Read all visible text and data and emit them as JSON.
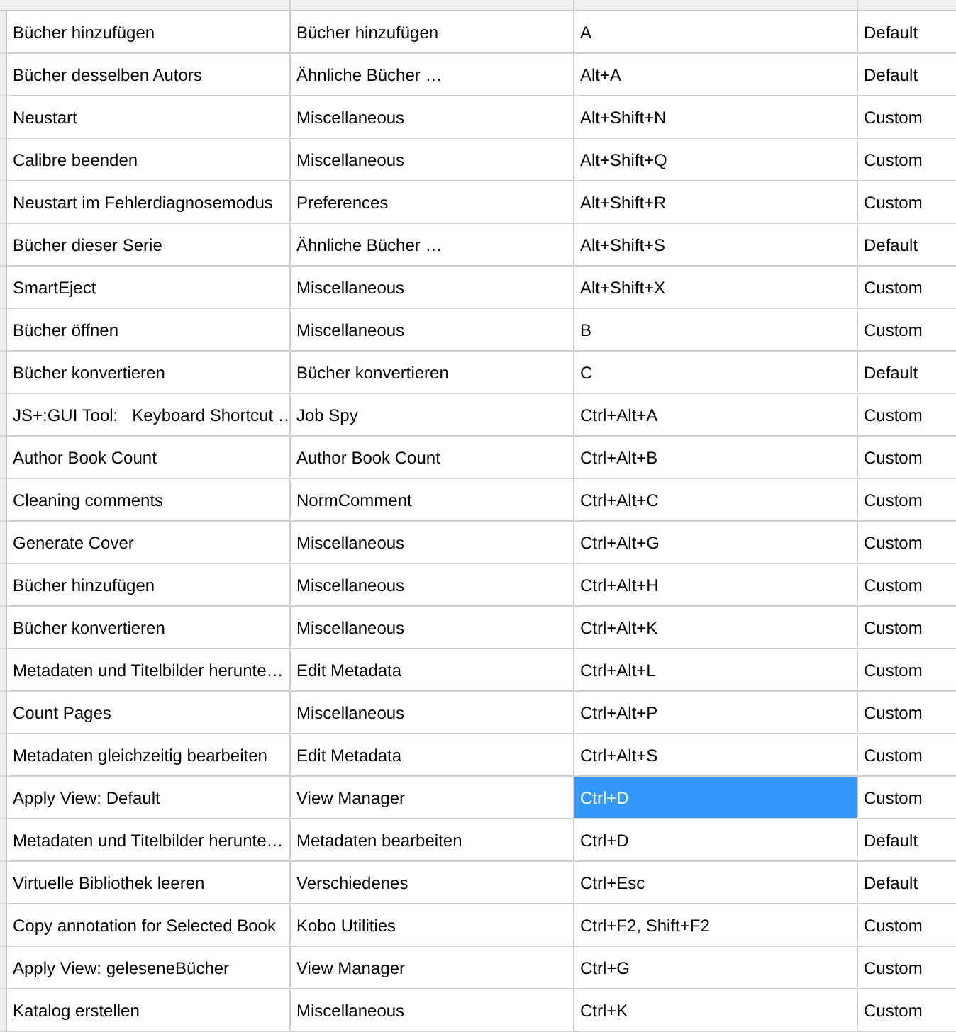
{
  "table": {
    "rows": [
      {
        "name": "Bücher hinzufügen",
        "group": "Bücher hinzufügen",
        "shortcut": "A",
        "source": "Default",
        "selected": false
      },
      {
        "name": "Bücher desselben Autors",
        "group": "Ähnliche Bücher …",
        "shortcut": "Alt+A",
        "source": "Default",
        "selected": false
      },
      {
        "name": "Neustart",
        "group": "Miscellaneous",
        "shortcut": "Alt+Shift+N",
        "source": "Custom",
        "selected": false
      },
      {
        "name": "Calibre beenden",
        "group": "Miscellaneous",
        "shortcut": "Alt+Shift+Q",
        "source": "Custom",
        "selected": false
      },
      {
        "name": "Neustart im Fehlerdiagnosemodus",
        "group": "Preferences",
        "shortcut": "Alt+Shift+R",
        "source": "Custom",
        "selected": false
      },
      {
        "name": "Bücher dieser Serie",
        "group": "Ähnliche Bücher …",
        "shortcut": "Alt+Shift+S",
        "source": "Default",
        "selected": false
      },
      {
        "name": "SmartEject",
        "group": "Miscellaneous",
        "shortcut": "Alt+Shift+X",
        "source": "Custom",
        "selected": false
      },
      {
        "name": "Bücher öffnen",
        "group": "Miscellaneous",
        "shortcut": "B",
        "source": "Custom",
        "selected": false
      },
      {
        "name": "Bücher konvertieren",
        "group": "Bücher konvertieren",
        "shortcut": "C",
        "source": "Default",
        "selected": false
      },
      {
        "name": "JS+:GUI Tool:   Keyboard Shortcut …",
        "group": "Job Spy",
        "shortcut": "Ctrl+Alt+A",
        "source": "Custom",
        "selected": false
      },
      {
        "name": "Author Book Count",
        "group": "Author Book Count",
        "shortcut": "Ctrl+Alt+B",
        "source": "Custom",
        "selected": false
      },
      {
        "name": "Cleaning comments",
        "group": "NormComment",
        "shortcut": "Ctrl+Alt+C",
        "source": "Custom",
        "selected": false
      },
      {
        "name": "Generate Cover",
        "group": "Miscellaneous",
        "shortcut": "Ctrl+Alt+G",
        "source": "Custom",
        "selected": false
      },
      {
        "name": "Bücher hinzufügen",
        "group": "Miscellaneous",
        "shortcut": "Ctrl+Alt+H",
        "source": "Custom",
        "selected": false
      },
      {
        "name": "Bücher konvertieren",
        "group": "Miscellaneous",
        "shortcut": "Ctrl+Alt+K",
        "source": "Custom",
        "selected": false
      },
      {
        "name": "Metadaten und Titelbilder herunte…",
        "group": "Edit Metadata",
        "shortcut": "Ctrl+Alt+L",
        "source": "Custom",
        "selected": false
      },
      {
        "name": "Count Pages",
        "group": "Miscellaneous",
        "shortcut": "Ctrl+Alt+P",
        "source": "Custom",
        "selected": false
      },
      {
        "name": "Metadaten gleichzeitig bearbeiten",
        "group": "Edit Metadata",
        "shortcut": "Ctrl+Alt+S",
        "source": "Custom",
        "selected": false
      },
      {
        "name": "Apply View: Default",
        "group": "View Manager",
        "shortcut": "Ctrl+D",
        "source": "Custom",
        "selected": true
      },
      {
        "name": "Metadaten und Titelbilder herunte…",
        "group": "Metadaten bearbeiten",
        "shortcut": "Ctrl+D",
        "source": "Default",
        "selected": false
      },
      {
        "name": "Virtuelle Bibliothek leeren",
        "group": "Verschiedenes",
        "shortcut": "Ctrl+Esc",
        "source": "Default",
        "selected": false
      },
      {
        "name": "Copy annotation for Selected Book",
        "group": "Kobo Utilities",
        "shortcut": "Ctrl+F2, Shift+F2",
        "source": "Custom",
        "selected": false
      },
      {
        "name": "Apply View: geleseneBücher",
        "group": "View Manager",
        "shortcut": "Ctrl+G",
        "source": "Custom",
        "selected": false
      },
      {
        "name": "Katalog erstellen",
        "group": "Miscellaneous",
        "shortcut": "Ctrl+K",
        "source": "Custom",
        "selected": false
      }
    ]
  }
}
